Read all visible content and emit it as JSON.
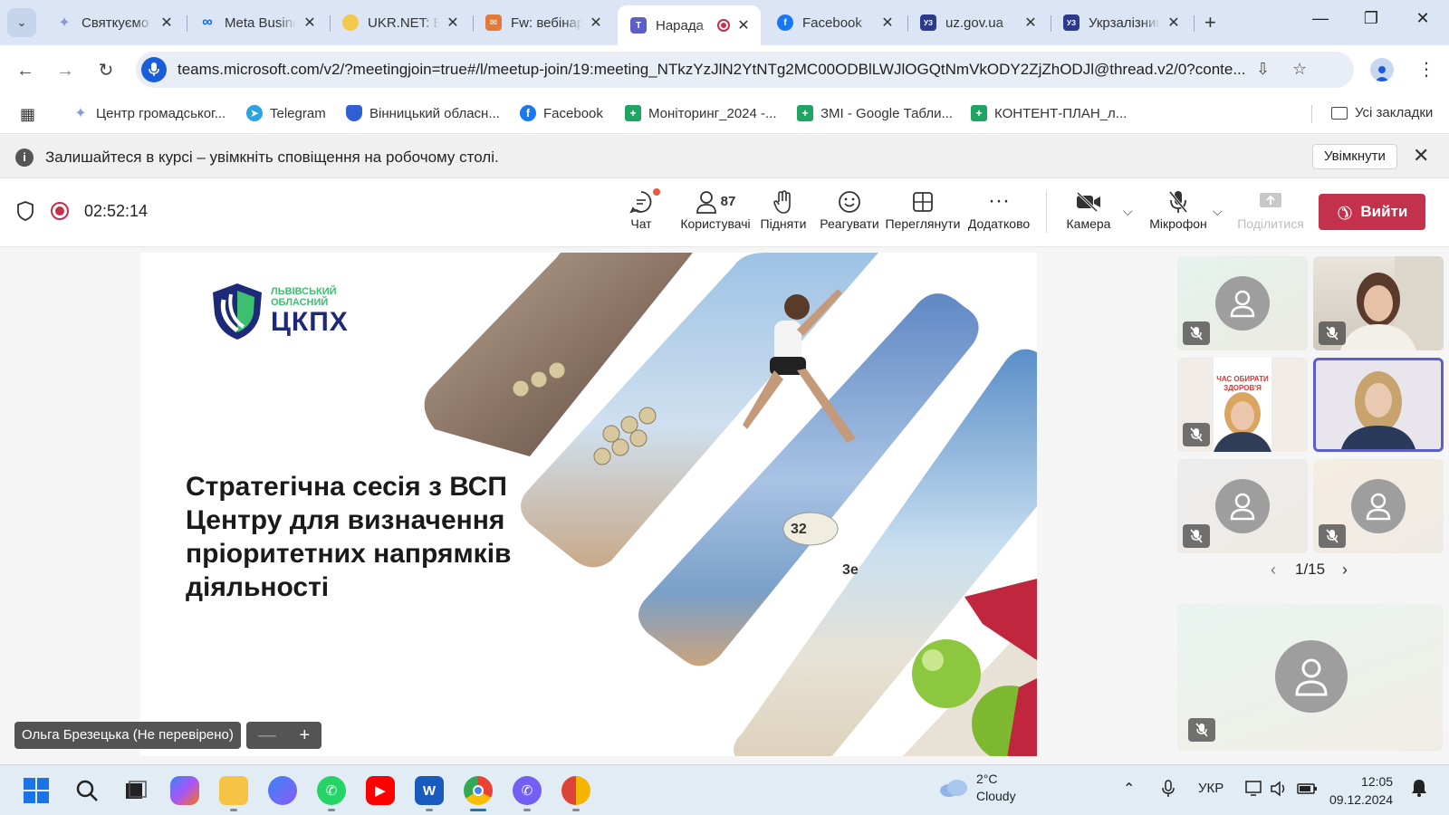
{
  "browser": {
    "tabs": [
      {
        "label": "Святкуємо",
        "color": "#8b9bd6"
      },
      {
        "label": "Meta Business",
        "color": "#0a66e6"
      },
      {
        "label": "UKR.NET: Е",
        "color": "#f2c94c"
      },
      {
        "label": "Fw: вебінар",
        "color": "#e07b39"
      },
      {
        "label": "Нарада",
        "color": "#5b5fc7",
        "active": true
      },
      {
        "label": "Facebook",
        "color": "#1877f2"
      },
      {
        "label": "uz.gov.ua",
        "color": "#2b3a8c"
      },
      {
        "label": "Укрзалізниця",
        "color": "#2b3a8c"
      }
    ],
    "url": "teams.microsoft.com/v2/?meetingjoin=true#/l/meetup-join/19:meeting_NTkzYzJlN2YtNTg2MC00ODBlLWJlOGQtNmVkODY2ZjZhODJl@thread.v2/0?conte...",
    "bookmarks": [
      {
        "label": "Центр громадськог...",
        "color": "#8b9bd6"
      },
      {
        "label": "Telegram",
        "color": "#2aa3e0"
      },
      {
        "label": "Вінницький обласн...",
        "color": "#2f5fd0"
      },
      {
        "label": "Facebook",
        "color": "#1877f2"
      },
      {
        "label": "Моніторинг_2024 -...",
        "color": "#1fa463"
      },
      {
        "label": "ЗМІ - Google Табли...",
        "color": "#1fa463"
      },
      {
        "label": "КОНТЕНТ-ПЛАН_л...",
        "color": "#1fa463"
      }
    ],
    "all_bookmarks": "Усі закладки"
  },
  "notification": {
    "text": "Залишайтеся в курсі – увімкніть сповіщення на робочому столі.",
    "button": "Увімкнути"
  },
  "meeting": {
    "timer": "02:52:14",
    "tools": {
      "chat": "Чат",
      "people": "Користувачі",
      "people_count": "87",
      "raise": "Підняти",
      "react": "Реагувати",
      "view": "Переглянути",
      "more": "Додатково",
      "camera": "Камера",
      "mic": "Мікрофон",
      "share": "Поділитися"
    },
    "leave": "Вийти",
    "pager": "1/15",
    "speaker_name": "Ольга Брезецька (Не перевірено)"
  },
  "slide": {
    "logo_small_1": "ЛЬВІВСЬКИЙ",
    "logo_small_2": "ОБЛАСНИЙ",
    "logo_big": "ЦКПХ",
    "title": "Стратегічна сесія з ВСП Центру для визначення пріоритетних напрямків діяльності",
    "tile_poster_line1": "ЧАС ОБИРАТИ",
    "tile_poster_line2": "ЗДОРОВ'Я",
    "tape_1": "32",
    "tape_2": "3e"
  },
  "taskbar": {
    "weather_temp": "2°C",
    "weather_desc": "Cloudy",
    "lang": "УКР",
    "time": "12:05",
    "date": "09.12.2024"
  }
}
